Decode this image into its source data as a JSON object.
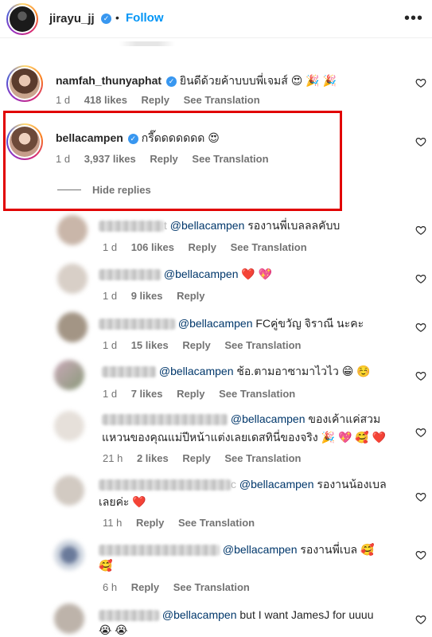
{
  "header": {
    "username": "jirayu_jj",
    "dot": "•",
    "follow_label": "Follow",
    "more": "•••"
  },
  "hide_replies_label": "Hide replies",
  "comments": [
    {
      "username": "namfah_thunyaphat",
      "text": "ยินดีด้วยค้าบบบพี่เจมส์",
      "emoji": "😍 🎉 🎉",
      "time": "1 d",
      "likes": "418 likes",
      "reply": "Reply",
      "translation": "See Translation"
    },
    {
      "username": "bellacampen",
      "text": "กรี๊ดดดดดดด",
      "emoji": "😍",
      "time": "1 d",
      "likes": "3,937 likes",
      "reply": "Reply",
      "translation": "See Translation"
    }
  ],
  "replies": [
    {
      "suffix": "t",
      "mention": "@bellacampen",
      "text": "รองานพี่เบลลลคับบ",
      "emoji": "",
      "line2": "",
      "time": "1 d",
      "likes": "106 likes",
      "reply": "Reply",
      "translation": "See Translation"
    },
    {
      "suffix": "",
      "mention": "@bellacampen",
      "text": "",
      "emoji": "❤️ 💖",
      "line2": "",
      "time": "1 d",
      "likes": "9 likes",
      "reply": "Reply",
      "translation": ""
    },
    {
      "suffix": "",
      "mention": "@bellacampen",
      "text": "FCคู่ขวัญ จิราณี นะคะ",
      "emoji": "",
      "line2": "",
      "time": "1 d",
      "likes": "15 likes",
      "reply": "Reply",
      "translation": "See Translation"
    },
    {
      "suffix": "",
      "mention": "@bellacampen",
      "text": "ช้อ.ตามอาซามาไวไว",
      "emoji": "😁 ☺️",
      "line2": "",
      "time": "1 d",
      "likes": "7 likes",
      "reply": "Reply",
      "translation": "See Translation"
    },
    {
      "suffix": "",
      "mention": "@bellacampen",
      "text": "ของเค้าแค่สวม",
      "emoji": "",
      "line2": "แหวนของคุณแม่ปีหน้าแต่งเลยเดสทินี่ของจริง",
      "line2_emoji": "🎉 💖 🥰 ❤️",
      "time": "21 h",
      "likes": "2 likes",
      "reply": "Reply",
      "translation": "See Translation"
    },
    {
      "suffix": "c",
      "mention": "@bellacampen",
      "text": "รองานน้องเบล",
      "emoji": "",
      "line2": "เลยค่ะ",
      "line2_emoji": "❤️",
      "time": "11 h",
      "likes": "",
      "reply": "Reply",
      "translation": "See Translation"
    },
    {
      "suffix": "",
      "mention": "@bellacampen",
      "text": "รองานพี่เบล",
      "emoji": "🥰",
      "line2": "",
      "line2_emoji": "🥰",
      "time": "6 h",
      "likes": "",
      "reply": "Reply",
      "translation": "See Translation"
    },
    {
      "suffix": "",
      "mention": "@bellacampen",
      "text": "but I want JamesJ for uuuu",
      "emoji": "",
      "line2": "",
      "line2_emoji": "😭 😭",
      "time": "",
      "likes": "",
      "reply": "",
      "translation": ""
    }
  ]
}
